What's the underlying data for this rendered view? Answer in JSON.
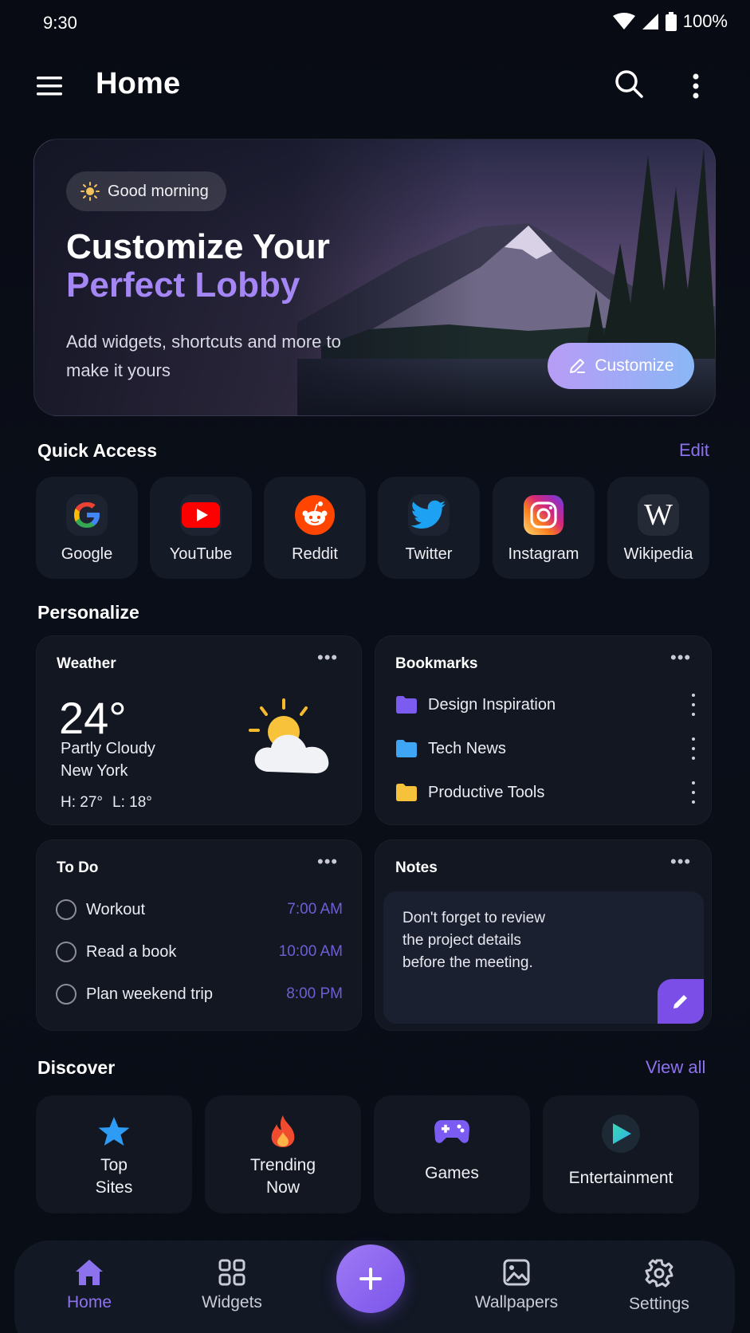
{
  "status_bar": {
    "time": "9:30",
    "battery": "100%"
  },
  "app_bar": {
    "title": "Home"
  },
  "hero": {
    "chip": "Good morning",
    "title_line1": "Customize Your",
    "title_line2": "Perfect Lobby",
    "subtitle": "Add widgets, shortcuts and more to make it yours",
    "button": "Customize"
  },
  "quick_access": {
    "title": "Quick Access",
    "edit": "Edit",
    "items": [
      {
        "label": "Google",
        "icon": "google-icon"
      },
      {
        "label": "YouTube",
        "icon": "youtube-icon"
      },
      {
        "label": "Reddit",
        "icon": "reddit-icon"
      },
      {
        "label": "Twitter",
        "icon": "twitter-icon"
      },
      {
        "label": "Instagram",
        "icon": "instagram-icon"
      },
      {
        "label": "Wikipedia",
        "icon": "wikipedia-icon"
      }
    ]
  },
  "personalize": {
    "title": "Personalize",
    "weather": {
      "title": "Weather",
      "temp": "24°",
      "condition": "Partly Cloudy",
      "city": "New York",
      "high": "H: 27°",
      "low": "L: 18°"
    },
    "bookmarks": {
      "title": "Bookmarks",
      "items": [
        {
          "label": "Design Inspiration",
          "color": "#7c5cf0"
        },
        {
          "label": "Tech News",
          "color": "#3ea6f5"
        },
        {
          "label": "Productive Tools",
          "color": "#f7c23b"
        }
      ]
    },
    "todo": {
      "title": "To Do",
      "items": [
        {
          "label": "Workout",
          "time": "7:00 AM"
        },
        {
          "label": "Read a book",
          "time": "10:00 AM"
        },
        {
          "label": "Plan weekend trip",
          "time": "8:00 PM"
        }
      ]
    },
    "notes": {
      "title": "Notes",
      "text_line1": "Don't forget to review",
      "text_line2": "the project details",
      "text_line3": "before the meeting."
    }
  },
  "discover": {
    "title": "Discover",
    "view_all": "View all",
    "items": [
      {
        "line1": "Top",
        "line2": "Sites",
        "icon": "star-icon"
      },
      {
        "line1": "Trending",
        "line2": "Now",
        "icon": "fire-icon"
      },
      {
        "line1": "Games",
        "line2": "",
        "icon": "gamepad-icon"
      },
      {
        "line1": "Entertainment",
        "line2": "",
        "icon": "play-icon"
      }
    ]
  },
  "bottom_nav": {
    "items": [
      {
        "label": "Home",
        "active": true
      },
      {
        "label": "Widgets",
        "active": false
      },
      {
        "label": "Wallpapers",
        "active": false
      },
      {
        "label": "Settings",
        "active": false
      }
    ]
  },
  "colors": {
    "accent": "#8d72ee",
    "background": "#0a0e18",
    "card": "#121722"
  }
}
